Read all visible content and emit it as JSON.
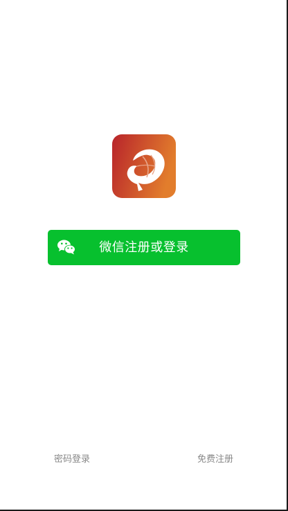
{
  "colors": {
    "wechat_green": "#07c02e",
    "logo_gradient_start": "#b8242b",
    "logo_gradient_end": "#e27d2c",
    "footer_text": "#888888"
  },
  "logo": {
    "icon": "fish-app-logo-icon"
  },
  "wechat_login": {
    "label": "微信注册或登录",
    "icon": "wechat-icon"
  },
  "footer": {
    "password_login_label": "密码登录",
    "free_register_label": "免费注册"
  }
}
